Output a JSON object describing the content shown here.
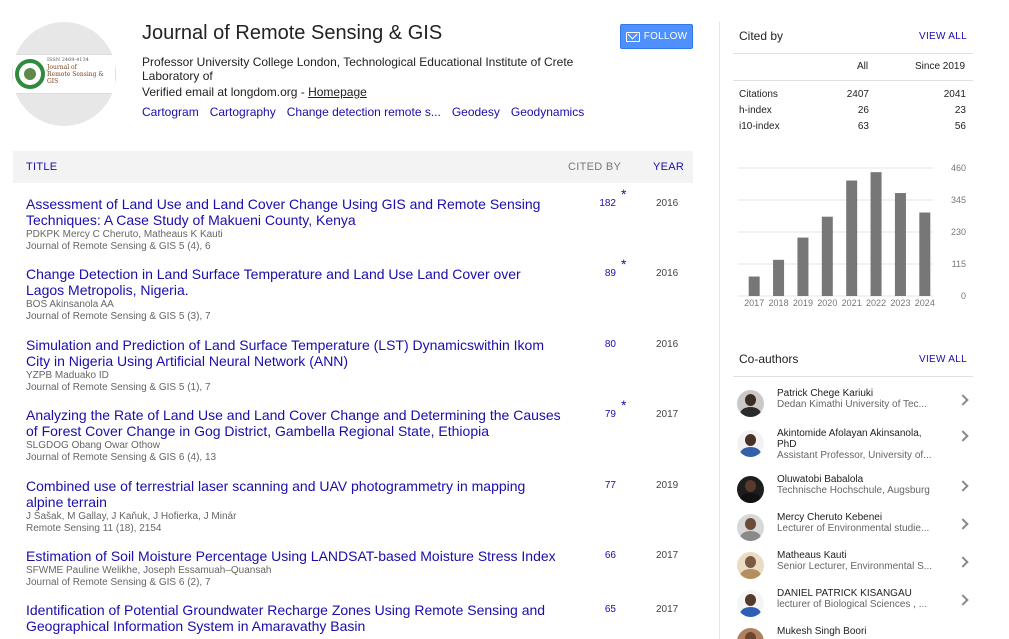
{
  "profile": {
    "name": "Journal of Remote Sensing & GIS",
    "affiliation": "Professor University College London, Technological Educational Institute of Crete Laboratory of",
    "email_text": "Verified email at longdom.org - ",
    "homepage_label": "Homepage",
    "logo_issn": "ISSN 2469-4134",
    "logo_line1": "Journal of",
    "logo_line2": "Remote Sensing &",
    "logo_line3": "GIS",
    "interests": [
      "Cartogram",
      "Cartography",
      "Change detection remote s...",
      "Geodesy",
      "Geodynamics"
    ]
  },
  "follow": {
    "label": "FOLLOW"
  },
  "table": {
    "headers": {
      "title": "TITLE",
      "cited_by": "CITED BY",
      "year": "YEAR"
    },
    "rows": [
      {
        "title": "Assessment of Land Use and Land Cover Change Using GIS and Remote Sensing Techniques: A Case Study of Makueni County, Kenya",
        "authors": "PDKPK Mercy C Cheruto, Matheaus K Kauti",
        "venue": "Journal of Remote Sensing & GIS 5 (4), 6",
        "cited": "182",
        "star": "*",
        "year": "2016"
      },
      {
        "title": "Change Detection in Land Surface Temperature and Land Use Land Cover over Lagos Metropolis, Nigeria.",
        "authors": "BOS Akinsanola AA",
        "venue": "Journal of Remote Sensing & GIS 5 (3), 7",
        "cited": "89",
        "star": "*",
        "year": "2016"
      },
      {
        "title": "Simulation and Prediction of Land Surface Temperature (LST) Dynamicswithin Ikom City in Nigeria Using Artificial Neural Network (ANN)",
        "authors": "YZPB Maduako ID",
        "venue": "Journal of Remote Sensing & GIS 5 (1), 7",
        "cited": "80",
        "star": "",
        "year": "2016"
      },
      {
        "title": "Analyzing the Rate of Land Use and Land Cover Change and Determining the Causes of Forest Cover Change in Gog District, Gambella Regional State, Ethiopia",
        "authors": "SLGDOG Obang Owar Othow",
        "venue": "Journal of Remote Sensing & GIS 6 (4), 13",
        "cited": "79",
        "star": "*",
        "year": "2017"
      },
      {
        "title": "Combined use of terrestrial laser scanning and UAV photogrammetry in mapping alpine terrain",
        "authors": "J Šašak, M Gallay, J Kaňuk, J Hofierka, J Minár",
        "venue": "Remote Sensing 11 (18), 2154",
        "cited": "77",
        "star": "",
        "year": "2019"
      },
      {
        "title": "Estimation of Soil Moisture Percentage Using LANDSAT-based Moisture Stress Index",
        "authors": "SFWME Pauline Welikhe, Joseph Essamuah–Quansah",
        "venue": "Journal of Remote Sensing & GIS 6 (2), 7",
        "cited": "66",
        "star": "",
        "year": "2017"
      },
      {
        "title": "Identification of Potential Groundwater Recharge Zones Using Remote Sensing and Geographical Information System in Amaravathy Basin",
        "authors": "",
        "venue": "",
        "cited": "65",
        "star": "",
        "year": "2017"
      }
    ]
  },
  "cited_by": {
    "title": "Cited by",
    "view_all": "VIEW ALL",
    "col_all": "All",
    "col_since": "Since 2019",
    "rows": [
      {
        "label": "Citations",
        "all": "2407",
        "since": "2041"
      },
      {
        "label": "h-index",
        "all": "26",
        "since": "23"
      },
      {
        "label": "i10-index",
        "all": "63",
        "since": "56"
      }
    ]
  },
  "chart_data": {
    "type": "bar",
    "categories": [
      "2017",
      "2018",
      "2019",
      "2020",
      "2021",
      "2022",
      "2023",
      "2024"
    ],
    "values": [
      70,
      130,
      210,
      285,
      415,
      445,
      370,
      300
    ],
    "y_ticks": [
      "460",
      "345",
      "230",
      "115",
      "0"
    ],
    "ylim": [
      0,
      460
    ],
    "grid": true,
    "bar_color": "#777777"
  },
  "coauthors": {
    "title": "Co-authors",
    "view_all": "VIEW ALL",
    "items": [
      {
        "name": "Patrick Chege Kariuki",
        "aff": "Dedan Kimathi University of Tec..."
      },
      {
        "name": "Akintomide Afolayan Akinsanola, PhD",
        "aff": "Assistant Professor, University of..."
      },
      {
        "name": "Oluwatobi Babalola",
        "aff": "Technische Hochschule, Augsburg"
      },
      {
        "name": "Mercy Cheruto Kebenei",
        "aff": "Lecturer of Environmental studie..."
      },
      {
        "name": "Matheaus Kauti",
        "aff": "Senior Lecturer, Environmental S..."
      },
      {
        "name": "DANIEL PATRICK KISANGAU",
        "aff": "lecturer of Biological Sciences , ..."
      },
      {
        "name": "Mukesh Singh Boori",
        "aff": ""
      }
    ]
  }
}
